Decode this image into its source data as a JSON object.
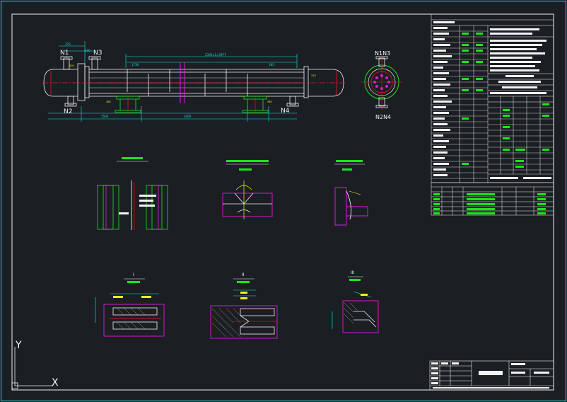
{
  "nozzle_labels": {
    "n1": "N1",
    "n3": "N3",
    "n2": "N2",
    "n4": "N4",
    "n1n3": "N1N3",
    "n2n4": "N2N4"
  },
  "section_marks": {
    "i": "I",
    "ii": "II",
    "iii": "III"
  },
  "axis": {
    "y": "Y",
    "x": "X"
  },
  "colors": {
    "background": "#1b1f23",
    "white": "#f2f2f2",
    "cyan": "#19e3e3",
    "green": "#19e619",
    "yellow": "#f2f21a",
    "red": "#f21a1a",
    "magenta": "#e31ae3",
    "blue": "#3a6bff"
  }
}
